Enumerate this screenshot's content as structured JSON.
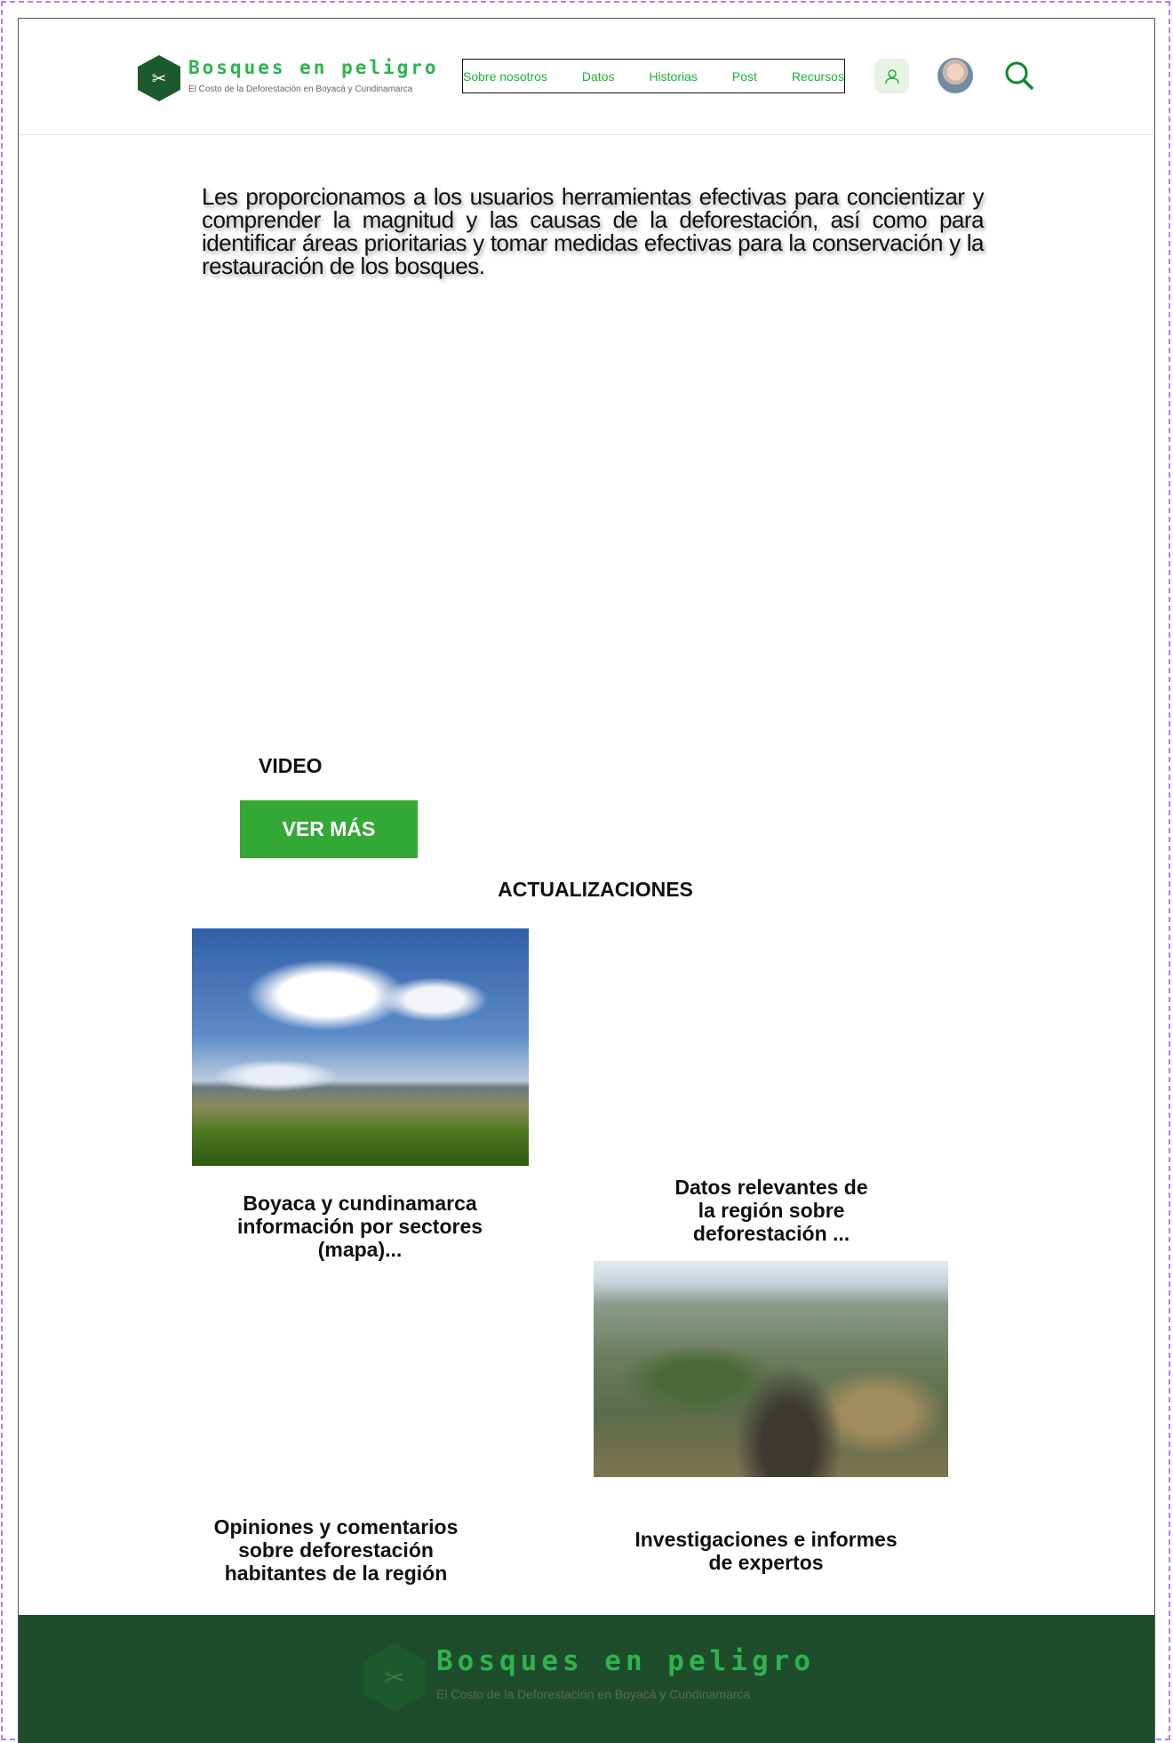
{
  "header": {
    "logo_title": "Bosques en peligro",
    "logo_subtitle": "El Costo de la Deforestación en Boyacá y Cundinamarca",
    "nav": [
      "Sobre nosotros",
      "Datos",
      "Historias",
      "Post",
      "Recursos"
    ]
  },
  "intro": "Les proporcionamos a los usuarios herramientas efectivas para concientizar y comprender la magnitud y las causas de la deforestación, así como para identificar áreas prioritarias y tomar medidas efectivas para la conservación y la restauración de los bosques.",
  "video": {
    "label": "VIDEO",
    "button": "VER MÁS"
  },
  "updates": {
    "title": "ACTUALIZACIONES",
    "items": [
      "Boyaca y cundinamarca\ninformación por sectores\n(mapa)...",
      "Datos relevantes de\nla región sobre\ndeforestación ...",
      "Opiniones y comentarios\nsobre deforestación\nhabitantes de la región",
      "Investigaciones e informes\nde expertos"
    ]
  },
  "footer": {
    "logo_title": "Bosques en peligro",
    "logo_subtitle": "El Costo de la Deforestación en Boyacá y Cundinamarca"
  },
  "colors": {
    "brand_green": "#2fb34d",
    "button_green": "#34a835",
    "footer_bg": "#1e4d2b"
  }
}
